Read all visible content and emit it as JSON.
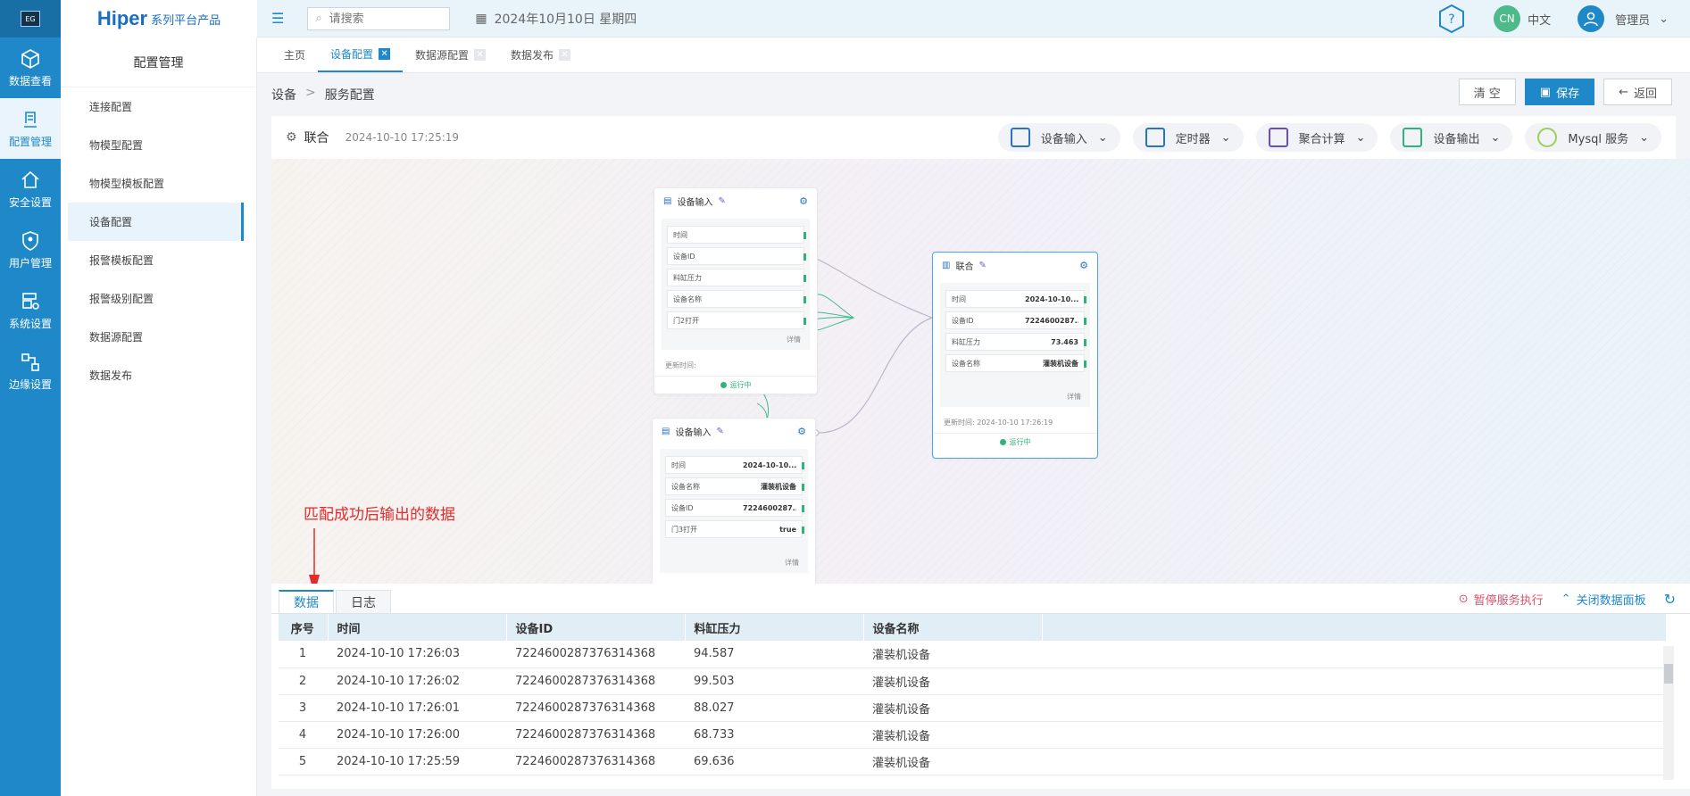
{
  "rail": [
    {
      "label": "数据查看",
      "icon": "cube-icon"
    },
    {
      "label": "配置管理",
      "icon": "config-icon"
    },
    {
      "label": "安全设置",
      "icon": "home-lock-icon"
    },
    {
      "label": "用户管理",
      "icon": "shield-user-icon"
    },
    {
      "label": "系统设置",
      "icon": "system-gear-icon"
    },
    {
      "label": "边缘设置",
      "icon": "edge-nodes-icon"
    }
  ],
  "brand": {
    "big": "Hiper",
    "small": "系列平台产品"
  },
  "sidebar": {
    "title": "配置管理",
    "items": [
      "连接配置",
      "物模型配置",
      "物模型模板配置",
      "设备配置",
      "报警模板配置",
      "报警级别配置",
      "数据源配置",
      "数据发布"
    ]
  },
  "header": {
    "search_placeholder": "请搜索",
    "date": "2024年10月10日 星期四",
    "lang_badge": "CN",
    "lang": "中文",
    "user": "管理员"
  },
  "tabs": [
    "主页",
    "设备配置",
    "数据源配置",
    "数据发布"
  ],
  "breadcrumb": {
    "root": "设备",
    "sep": ">",
    "current": "服务配置"
  },
  "actions": {
    "clear": "清 空",
    "save": "保存",
    "back": "返回"
  },
  "toolbar": {
    "title": "联合",
    "timestamp": "2024-10-10 17:25:19",
    "tools": [
      "设备输入",
      "定时器",
      "聚合计算",
      "设备输出",
      "Mysql 服务"
    ]
  },
  "nodes": {
    "input1": {
      "title": "设备输入",
      "fields": [
        "时间",
        "设备ID",
        "料缸压力",
        "设备名称",
        "门2打开"
      ],
      "detail": "详情",
      "update": "更新时间:",
      "status": "运行中"
    },
    "input2": {
      "title": "设备输入",
      "fields": [
        {
          "label": "时间",
          "value": "2024-10-10..."
        },
        {
          "label": "设备名称",
          "value": "灌装机设备"
        },
        {
          "label": "设备ID",
          "value": "7224600287..."
        },
        {
          "label": "门3打开",
          "value": "true"
        }
      ],
      "detail": "详情"
    },
    "join": {
      "title": "联合",
      "fields": [
        {
          "label": "时间",
          "value": "2024-10-10..."
        },
        {
          "label": "设备ID",
          "value": "7224600287..."
        },
        {
          "label": "料缸压力",
          "value": "73.463"
        },
        {
          "label": "设备名称",
          "value": "灌装机设备"
        }
      ],
      "detail": "详情",
      "update": "更新时间: 2024-10-10 17:26:19",
      "status": "运行中"
    }
  },
  "annotation": "匹配成功后输出的数据",
  "bottom": {
    "tabs": [
      "数据",
      "日志"
    ],
    "pause": "暂停服务执行",
    "close": "关闭数据面板",
    "columns": [
      "序号",
      "时间",
      "设备ID",
      "料缸压力",
      "设备名称"
    ],
    "rows": [
      [
        "1",
        "2024-10-10 17:26:03",
        "7224600287376314368",
        "94.587",
        "灌装机设备"
      ],
      [
        "2",
        "2024-10-10 17:26:02",
        "7224600287376314368",
        "99.503",
        "灌装机设备"
      ],
      [
        "3",
        "2024-10-10 17:26:01",
        "7224600287376314368",
        "88.027",
        "灌装机设备"
      ],
      [
        "4",
        "2024-10-10 17:26:00",
        "7224600287376314368",
        "68.733",
        "灌装机设备"
      ],
      [
        "5",
        "2024-10-10 17:25:59",
        "7224600287376314368",
        "69.636",
        "灌装机设备"
      ]
    ]
  }
}
